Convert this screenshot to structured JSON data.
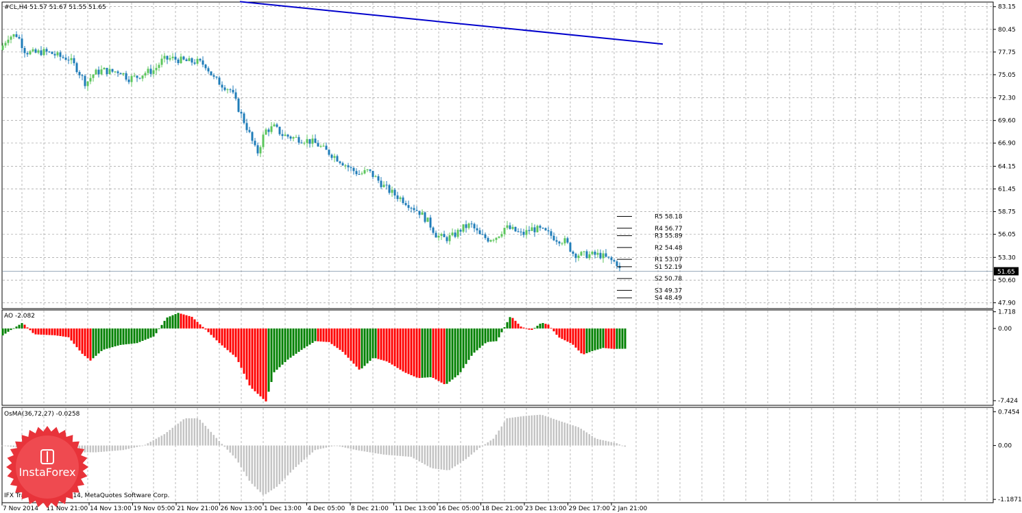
{
  "chart_data": [
    {
      "type": "candlestick",
      "panel": "price",
      "title": "#CL,H4  51.57 51.67 51.55 51.65",
      "last_price": "51.65",
      "ylim": [
        47.2,
        83.7
      ],
      "yticks": [
        "83.15",
        "80.45",
        "77.75",
        "75.05",
        "72.30",
        "69.60",
        "66.90",
        "64.15",
        "61.45",
        "58.75",
        "56.05",
        "53.30",
        "50.60",
        "47.90"
      ],
      "xticks": [
        "7 Nov 2014",
        "11 Nov 21:00",
        "14 Nov 13:00",
        "19 Nov 05:00",
        "21 Nov 21:00",
        "26 Nov 13:00",
        "1 Dec 13:00",
        "4 Dec 05:00",
        "8 Dec 21:00",
        "11 Dec 13:00",
        "16 Dec 05:00",
        "18 Dec 21:00",
        "23 Dec 13:00",
        "29 Dec 17:00",
        "2 Jan 21:00"
      ],
      "close_path": [
        [
          0,
          78.0
        ],
        [
          12,
          79.6
        ],
        [
          25,
          79.8
        ],
        [
          37,
          77.8
        ],
        [
          50,
          77.6
        ],
        [
          62,
          77.8
        ],
        [
          75,
          77.6
        ],
        [
          87,
          77.2
        ],
        [
          100,
          77.0
        ],
        [
          112,
          75.8
        ],
        [
          125,
          74.0
        ],
        [
          137,
          75.2
        ],
        [
          150,
          75.6
        ],
        [
          162,
          75.4
        ],
        [
          175,
          75.5
        ],
        [
          187,
          74.6
        ],
        [
          200,
          74.8
        ],
        [
          212,
          75.3
        ],
        [
          225,
          75.6
        ],
        [
          237,
          76.8
        ],
        [
          250,
          77.0
        ],
        [
          262,
          76.8
        ],
        [
          275,
          76.6
        ],
        [
          287,
          76.6
        ],
        [
          300,
          76.2
        ],
        [
          312,
          74.6
        ],
        [
          325,
          73.8
        ],
        [
          337,
          73.2
        ],
        [
          350,
          70.6
        ],
        [
          362,
          68.4
        ],
        [
          375,
          65.6
        ],
        [
          387,
          68.4
        ],
        [
          400,
          68.8
        ],
        [
          412,
          67.9
        ],
        [
          425,
          67.6
        ],
        [
          437,
          67.4
        ],
        [
          450,
          67.2
        ],
        [
          462,
          66.8
        ],
        [
          475,
          66.0
        ],
        [
          487,
          65.4
        ],
        [
          500,
          64.6
        ],
        [
          512,
          63.8
        ],
        [
          525,
          63.2
        ],
        [
          537,
          63.6
        ],
        [
          550,
          62.6
        ],
        [
          562,
          61.6
        ],
        [
          575,
          60.8
        ],
        [
          587,
          60.2
        ],
        [
          600,
          59.4
        ],
        [
          612,
          58.7
        ],
        [
          625,
          57.5
        ],
        [
          637,
          55.9
        ],
        [
          650,
          55.5
        ],
        [
          662,
          55.9
        ],
        [
          675,
          56.8
        ],
        [
          687,
          57.2
        ],
        [
          700,
          55.9
        ],
        [
          712,
          55.5
        ],
        [
          725,
          55.8
        ],
        [
          737,
          56.9
        ],
        [
          750,
          56.5
        ],
        [
          762,
          56.0
        ],
        [
          775,
          56.7
        ],
        [
          787,
          56.6
        ],
        [
          800,
          56.1
        ],
        [
          812,
          55.5
        ],
        [
          825,
          55.2
        ],
        [
          837,
          53.7
        ],
        [
          850,
          53.6
        ],
        [
          862,
          53.6
        ],
        [
          875,
          53.6
        ],
        [
          887,
          53.1
        ],
        [
          900,
          52.6
        ],
        [
          905,
          51.65
        ]
      ],
      "trendline": [
        [
          350,
          83.75
        ],
        [
          967,
          78.7
        ]
      ],
      "pivots": [
        {
          "label": "R5 58.18",
          "value": 58.18
        },
        {
          "label": "R4 56.77",
          "value": 56.77
        },
        {
          "label": "R3 55.89",
          "value": 55.89
        },
        {
          "label": "R2 54.48",
          "value": 54.48
        },
        {
          "label": "R1 53.07",
          "value": 53.07
        },
        {
          "label": "S1 52.19",
          "value": 52.19
        },
        {
          "label": "S2 50.78",
          "value": 50.78
        },
        {
          "label": "S3 49.37",
          "value": 49.37
        },
        {
          "label": "S4 48.49",
          "value": 48.49
        }
      ],
      "colors": {
        "up": "#5cc65c",
        "down": "#1f7cb8",
        "trendline": "#0000cc",
        "grid": "#8a8a8a"
      }
    },
    {
      "type": "bar",
      "panel": "AO",
      "title": "AO -2.082",
      "ylim": [
        -7.9,
        1.9
      ],
      "yticks": [
        "1.718",
        "0.00",
        "-7.424"
      ],
      "envelope": [
        [
          0,
          -0.9
        ],
        [
          15,
          -0.2
        ],
        [
          33,
          0.6
        ],
        [
          50,
          -0.6
        ],
        [
          80,
          -0.7
        ],
        [
          100,
          -0.9
        ],
        [
          120,
          -2.6
        ],
        [
          132,
          -3.3
        ],
        [
          150,
          -2.2
        ],
        [
          175,
          -1.7
        ],
        [
          200,
          -1.5
        ],
        [
          225,
          -0.8
        ],
        [
          243,
          1.1
        ],
        [
          260,
          1.6
        ],
        [
          280,
          1.2
        ],
        [
          300,
          -0.1
        ],
        [
          320,
          -1.5
        ],
        [
          345,
          -3.0
        ],
        [
          365,
          -6.0
        ],
        [
          388,
          -7.5
        ],
        [
          400,
          -4.5
        ],
        [
          420,
          -3.2
        ],
        [
          440,
          -2.2
        ],
        [
          460,
          -1.3
        ],
        [
          480,
          -1.4
        ],
        [
          500,
          -2.4
        ],
        [
          525,
          -4.3
        ],
        [
          545,
          -3.0
        ],
        [
          565,
          -3.4
        ],
        [
          590,
          -4.5
        ],
        [
          610,
          -5.1
        ],
        [
          630,
          -5.0
        ],
        [
          650,
          -5.8
        ],
        [
          670,
          -4.7
        ],
        [
          690,
          -2.6
        ],
        [
          710,
          -1.4
        ],
        [
          725,
          -1.3
        ],
        [
          745,
          1.3
        ],
        [
          760,
          0.2
        ],
        [
          775,
          -0.2
        ],
        [
          790,
          0.6
        ],
        [
          800,
          0.4
        ],
        [
          815,
          -0.9
        ],
        [
          835,
          -1.6
        ],
        [
          850,
          -2.7
        ],
        [
          865,
          -2.3
        ],
        [
          880,
          -2.0
        ],
        [
          895,
          -2.1
        ],
        [
          912,
          -2.082
        ]
      ],
      "colors": {
        "up": "#008000",
        "down": "#ff0000"
      }
    },
    {
      "type": "bar",
      "panel": "OsMA",
      "title": "OsMA(36,72,27) -0.0258",
      "ylim": [
        -1.26,
        0.84
      ],
      "yticks": [
        "0.7454",
        "0.00",
        "-1.1871"
      ],
      "envelope": [
        [
          0,
          0.0
        ],
        [
          60,
          -0.1
        ],
        [
          100,
          -0.15
        ],
        [
          140,
          -0.15
        ],
        [
          180,
          -0.1
        ],
        [
          210,
          0.0
        ],
        [
          240,
          0.25
        ],
        [
          270,
          0.6
        ],
        [
          290,
          0.6
        ],
        [
          320,
          0.1
        ],
        [
          345,
          -0.3
        ],
        [
          365,
          -0.8
        ],
        [
          385,
          -1.1
        ],
        [
          405,
          -0.9
        ],
        [
          430,
          -0.5
        ],
        [
          460,
          -0.1
        ],
        [
          490,
          0.0
        ],
        [
          520,
          -0.1
        ],
        [
          560,
          -0.2
        ],
        [
          600,
          -0.25
        ],
        [
          630,
          -0.5
        ],
        [
          655,
          -0.55
        ],
        [
          680,
          -0.3
        ],
        [
          700,
          -0.05
        ],
        [
          720,
          0.15
        ],
        [
          740,
          0.6
        ],
        [
          765,
          0.65
        ],
        [
          790,
          0.68
        ],
        [
          815,
          0.55
        ],
        [
          845,
          0.4
        ],
        [
          870,
          0.15
        ],
        [
          900,
          0.05
        ],
        [
          912,
          -0.0258
        ]
      ],
      "colors": {
        "bar": "#c4c4c4"
      }
    }
  ],
  "footer": {
    "text": "IFX Trader, © 2001-2014, MetaQuotes Software Corp."
  },
  "logo": {
    "text": "InstaForex",
    "color": "#e8333a"
  }
}
